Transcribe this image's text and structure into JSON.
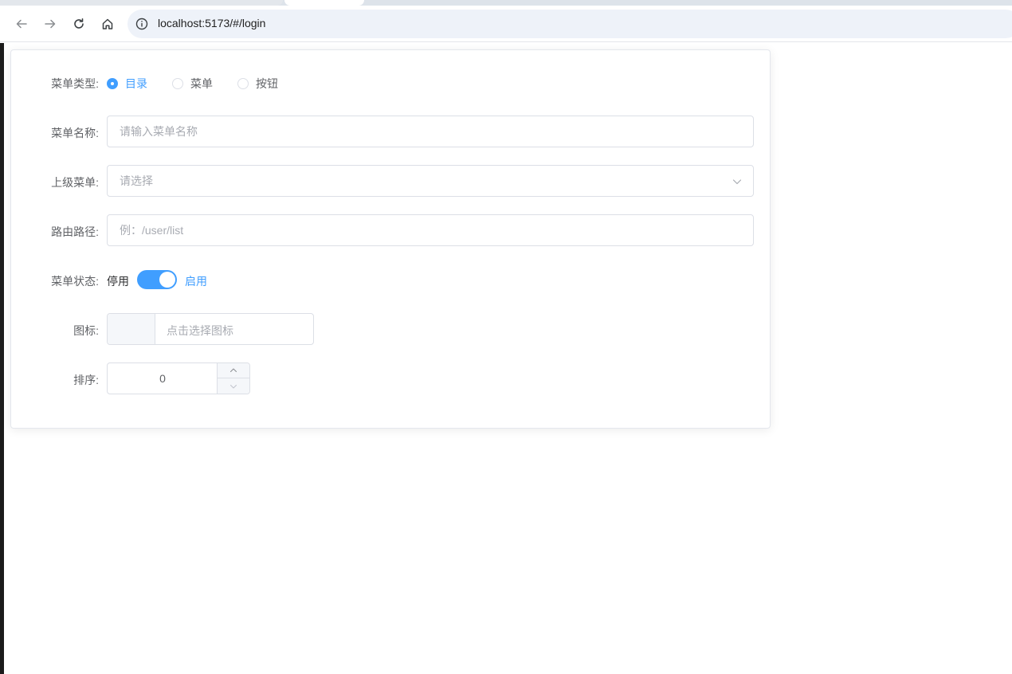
{
  "browser": {
    "url": "localhost:5173/#/login",
    "icons": [
      "back-icon",
      "forward-icon",
      "reload-icon",
      "home-icon",
      "info-icon"
    ]
  },
  "form": {
    "menu_type": {
      "label": "菜单类型:",
      "options": [
        {
          "label": "目录",
          "checked": true
        },
        {
          "label": "菜单",
          "checked": false
        },
        {
          "label": "按钮",
          "checked": false
        }
      ]
    },
    "menu_name": {
      "label": "菜单名称:",
      "placeholder": "请输入菜单名称"
    },
    "parent_menu": {
      "label": "上级菜单:",
      "placeholder": "请选择"
    },
    "route_path": {
      "label": "路由路径:",
      "placeholder": "例：/user/list"
    },
    "menu_status": {
      "label": "菜单状态:",
      "inactive_text": "停用",
      "active_text": "启用",
      "enabled": true
    },
    "icon": {
      "label": "图标:",
      "placeholder": "点击选择图标"
    },
    "sort": {
      "label": "排序:",
      "value": "0"
    }
  },
  "colors": {
    "primary": "#409eff",
    "label": "#606266",
    "placeholder": "#a8abb2",
    "border": "#dcdfe6"
  }
}
